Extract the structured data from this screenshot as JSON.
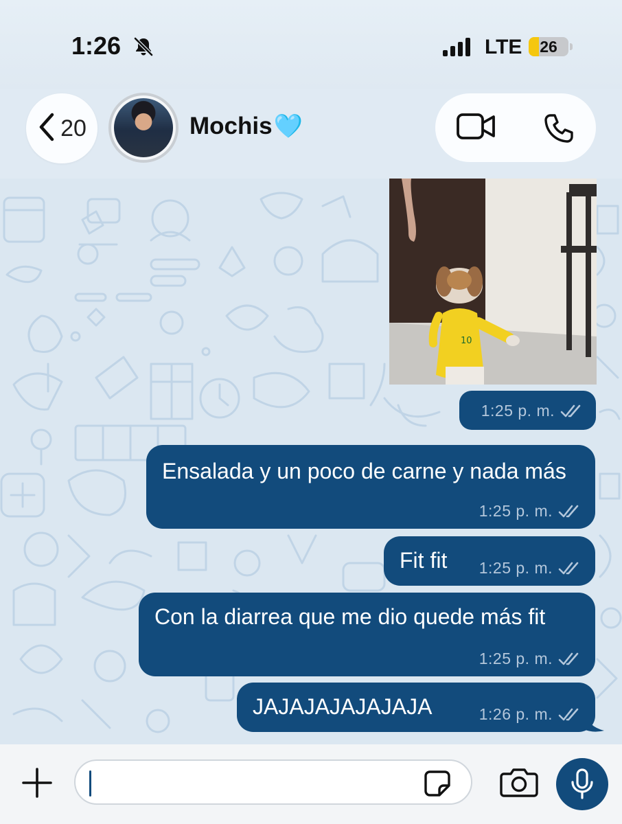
{
  "status_bar": {
    "time": "1:26",
    "network": "LTE",
    "battery": "26",
    "battery_level": 0.26,
    "icons": [
      "bell-slash-icon",
      "signal-icon",
      "battery-icon"
    ]
  },
  "header": {
    "back_count": "20",
    "contact_name": "Mochis",
    "contact_emoji": "🩵",
    "icons": [
      "chevron-left-icon",
      "video-camera-icon",
      "phone-icon"
    ]
  },
  "messages": [
    {
      "type": "media",
      "time": "1:25 p. m.",
      "status": "read"
    },
    {
      "type": "text",
      "text": "Ensalada y un poco de carne y nada más",
      "time": "1:25 p. m.",
      "status": "read"
    },
    {
      "type": "text",
      "text": "Fit fit",
      "time": "1:25 p. m.",
      "status": "read"
    },
    {
      "type": "text",
      "text": "Con la diarrea que me dio quede más fit",
      "time": "1:25 p. m.",
      "status": "read"
    },
    {
      "type": "text",
      "text": "JAJAJAJAJAJAJA",
      "time": "1:26 p. m.",
      "status": "read"
    }
  ],
  "composer": {
    "value": "",
    "icons": [
      "plus-icon",
      "sticker-icon",
      "camera-icon",
      "microphone-icon"
    ]
  },
  "colors": {
    "bubble": "#124b7c",
    "accent": "#124b7c",
    "battery_fill": "#f5c70f",
    "wallpaper": "#dbe7f1"
  }
}
